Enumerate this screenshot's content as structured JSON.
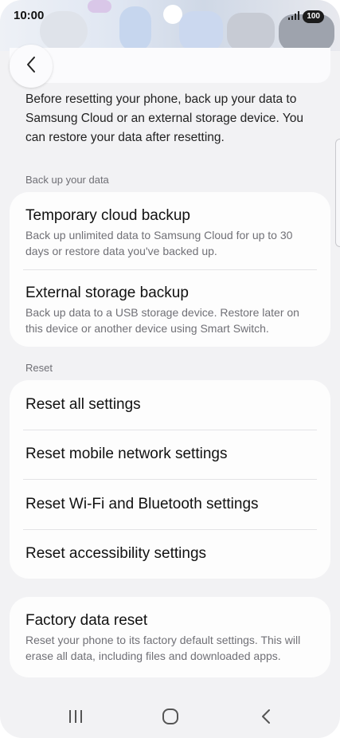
{
  "status_bar": {
    "time": "10:00",
    "signal_icon": "signal-bars-icon",
    "battery": "100"
  },
  "header": {
    "back_icon": "chevron-left-icon"
  },
  "intro_text": "Before resetting your phone, back up your data to Samsung Cloud or an external storage device. You can restore your data after resetting.",
  "backup_section": {
    "label": "Back up your data",
    "items": [
      {
        "title": "Temporary cloud backup",
        "subtitle": "Back up unlimited data to Samsung Cloud for up to 30 days or restore data you've backed up."
      },
      {
        "title": "External storage backup",
        "subtitle": "Back up data to a USB storage device. Restore later on this device or another device using Smart Switch."
      }
    ]
  },
  "reset_section": {
    "label": "Reset",
    "items": [
      {
        "title": "Reset all settings"
      },
      {
        "title": "Reset mobile network settings"
      },
      {
        "title": "Reset Wi-Fi and Bluetooth settings"
      },
      {
        "title": "Reset accessibility settings"
      }
    ]
  },
  "factory_reset": {
    "title": "Factory data reset",
    "subtitle": "Reset your phone to its factory default settings. This will erase all data, including files and downloaded apps."
  },
  "nav_bar": {
    "recents_icon": "recents-icon",
    "home_icon": "home-icon",
    "back_icon": "nav-back-icon"
  },
  "colors": {
    "background": "#f2f2f4",
    "card": "#fdfdfd",
    "primary_text": "#111111",
    "secondary_text": "#707076"
  }
}
